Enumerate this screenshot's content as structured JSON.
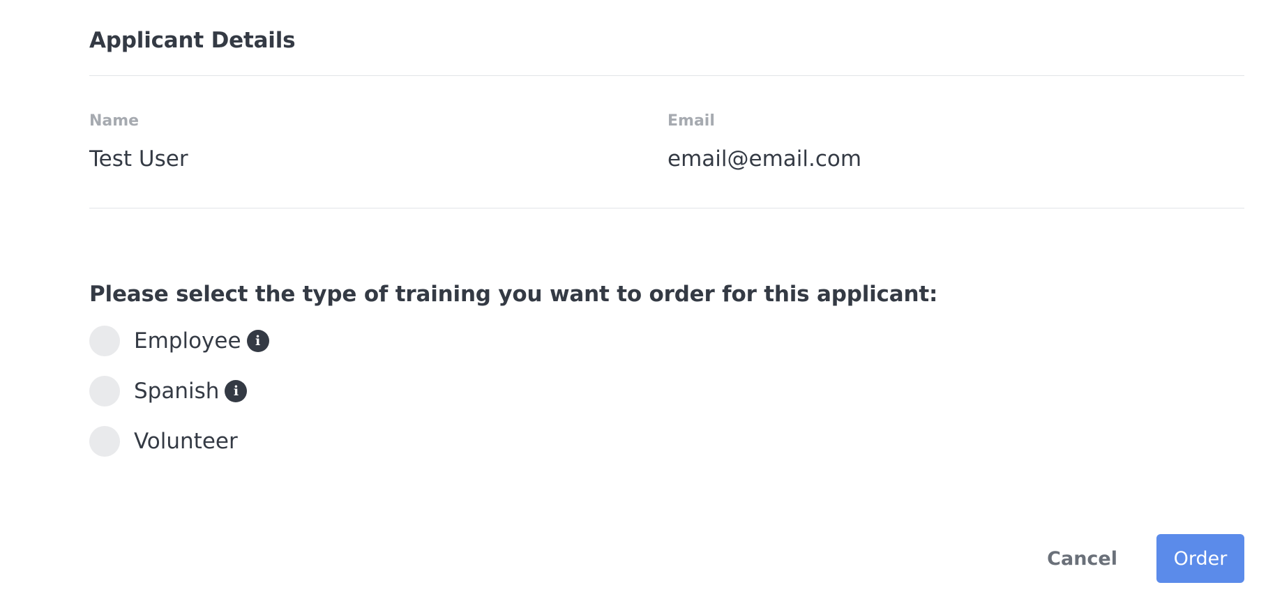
{
  "applicant": {
    "section_title": "Applicant Details",
    "name_label": "Name",
    "name_value": "Test User",
    "email_label": "Email",
    "email_value": "email@email.com"
  },
  "training": {
    "question": "Please select the type of training you want to order for this applicant:",
    "options": [
      {
        "label": "Employee",
        "has_info": true,
        "selected": false
      },
      {
        "label": "Spanish",
        "has_info": true,
        "selected": false
      },
      {
        "label": "Volunteer",
        "has_info": false,
        "selected": false
      }
    ],
    "info_icon_glyph": "i"
  },
  "actions": {
    "cancel_label": "Cancel",
    "order_label": "Order"
  },
  "colors": {
    "primary": "#5b8bea",
    "text": "#343a44",
    "muted": "#a6aab0",
    "radio_bg": "#e9eaec"
  }
}
